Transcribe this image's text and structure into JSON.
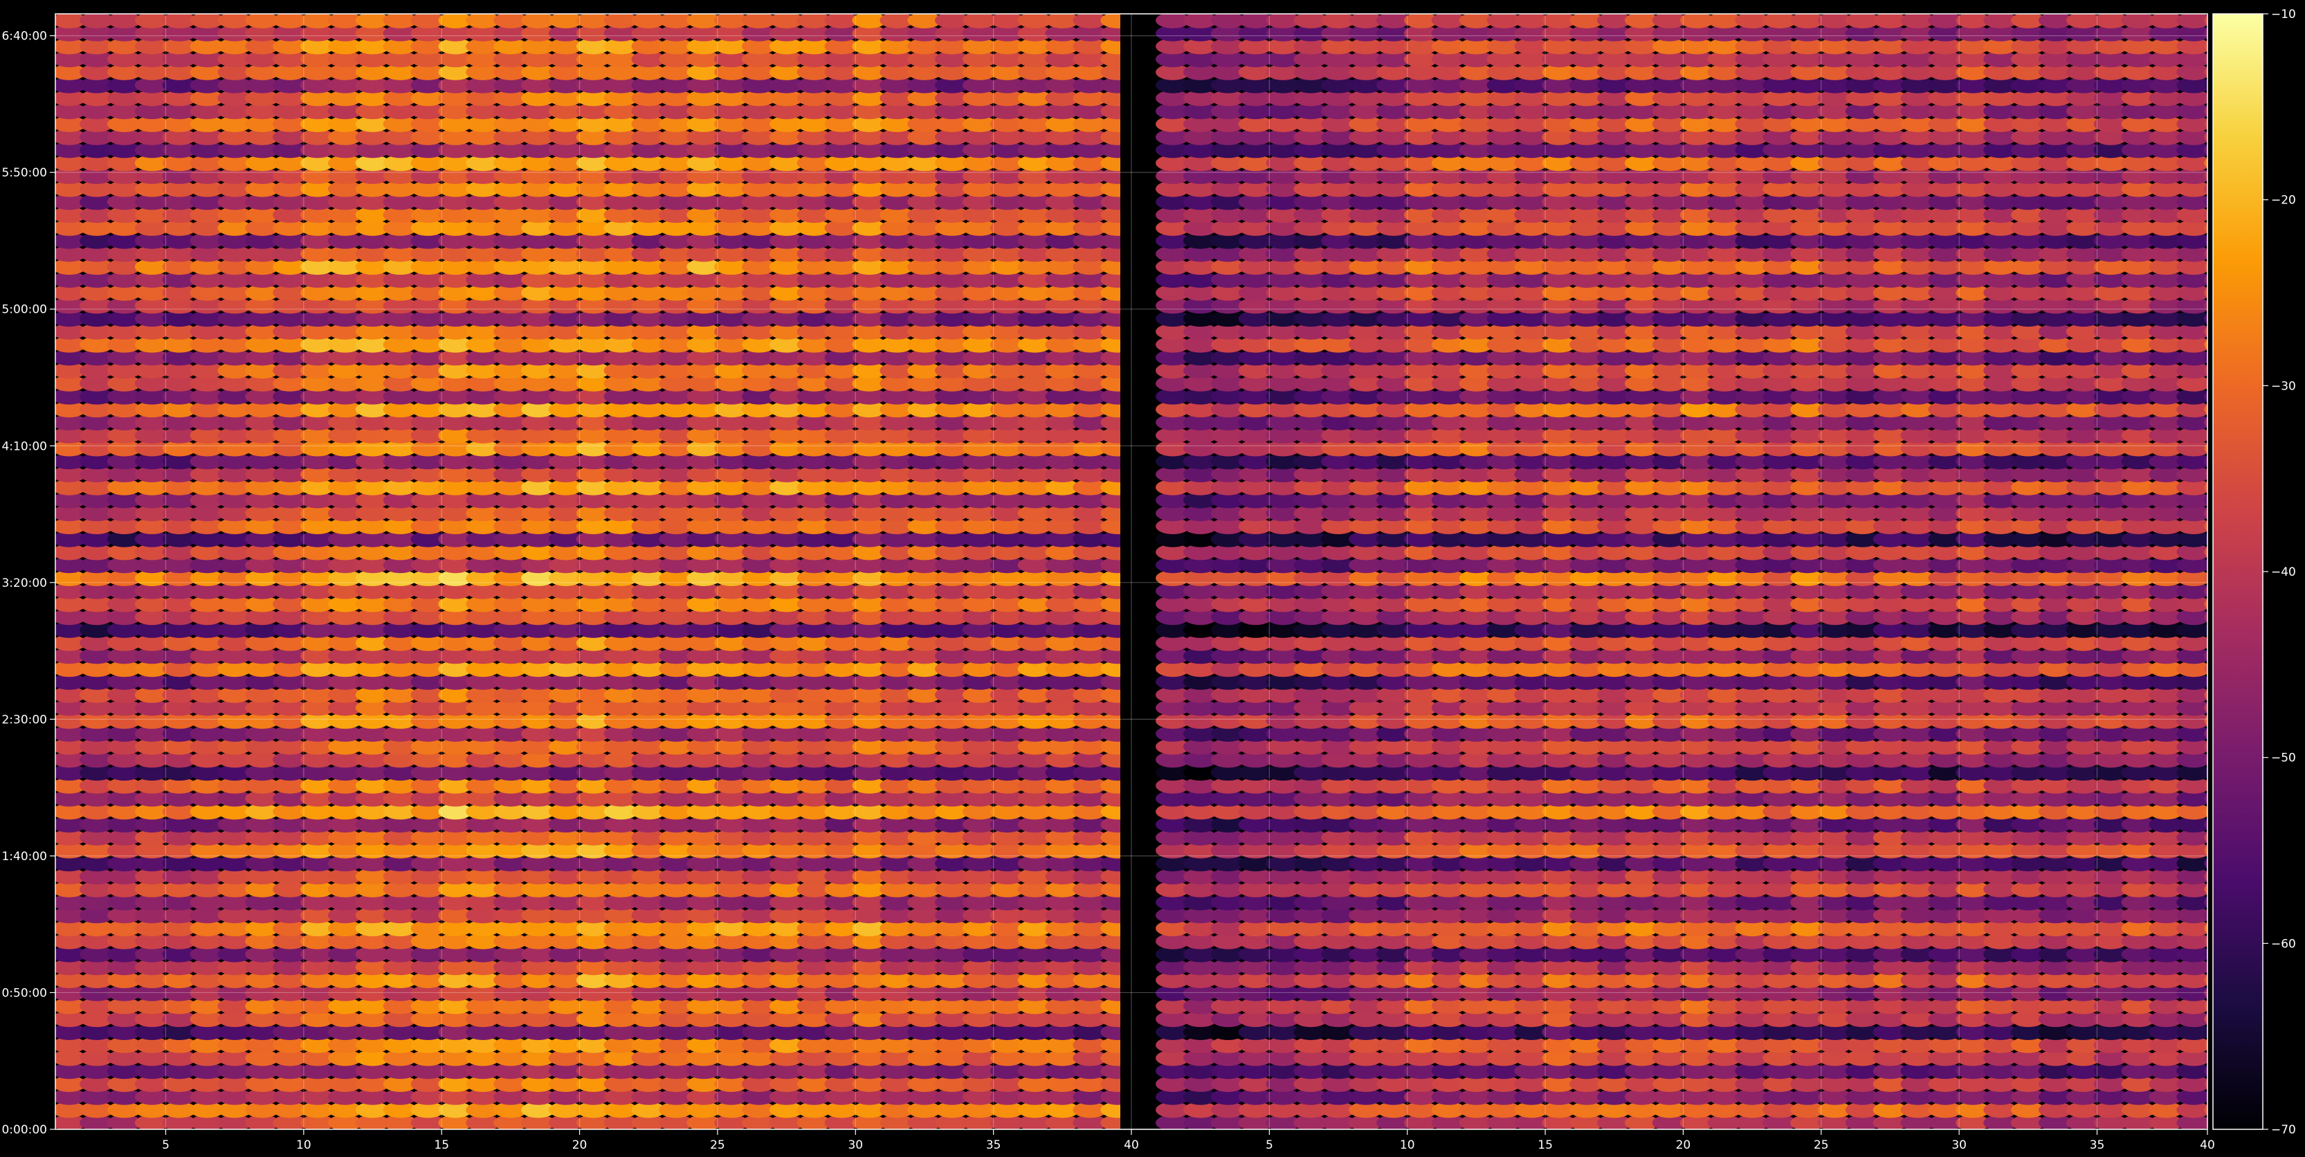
{
  "chart_data": {
    "type": "heatmap",
    "title": "",
    "xlabel": "",
    "ylabel": "",
    "grid": true,
    "background": "#000000",
    "colormap": "inferno",
    "colormap_stops": [
      "#000004",
      "#1b0c41",
      "#4a0c6b",
      "#781c6d",
      "#a52c60",
      "#cf4446",
      "#ed6925",
      "#fb9b06",
      "#f7d13d",
      "#fcffa4"
    ],
    "x_axis": {
      "range": [
        1,
        79
      ],
      "panel_split": 40,
      "ticks": [
        5,
        10,
        15,
        20,
        25,
        30,
        35,
        40,
        45,
        50,
        55,
        60,
        65,
        70,
        75,
        79
      ],
      "tick_labels": [
        "5",
        "10",
        "15",
        "20",
        "25",
        "30",
        "35",
        "40",
        "5",
        "10",
        "15",
        "20",
        "25",
        "30",
        "35",
        "40"
      ]
    },
    "y_axis": {
      "range_seconds": [
        0,
        24480
      ],
      "ticks_seconds": [
        0,
        3000,
        6000,
        9000,
        12000,
        15000,
        18000,
        21000,
        24000
      ],
      "tick_labels": [
        "0:00:00",
        "0:50:00",
        "1:40:00",
        "2:30:00",
        "3:20:00",
        "4:10:00",
        "5:00:00",
        "5:50:00",
        "6:40:00"
      ]
    },
    "colorbar": {
      "range": [
        -70,
        -10
      ],
      "ticks": [
        -70,
        -60,
        -50,
        -40,
        -30,
        -20,
        -10
      ],
      "tick_labels": [
        "−70",
        "−60",
        "−50",
        "−40",
        "−30",
        "−20",
        "−10"
      ]
    },
    "grid_shape": {
      "columns_per_panel": 39,
      "rows": 86
    },
    "panel_bias": [
      0,
      -7
    ],
    "row_levels": [
      -34,
      -24,
      -42,
      -30,
      -46,
      -30,
      -26,
      -52,
      -32,
      -28,
      -40,
      -26,
      -36,
      -48,
      -30,
      -24,
      -38,
      -44,
      -28,
      -34,
      -50,
      -26,
      -32,
      -46,
      -22,
      -40,
      -28,
      -52,
      -36,
      -30,
      -44,
      -26,
      -34,
      -30,
      -48,
      -24,
      -40,
      -28,
      -54,
      -36,
      -28,
      -38,
      -22,
      -44,
      -30,
      -52,
      -28,
      -34,
      -42,
      -24,
      -36,
      -48,
      -26,
      -32,
      -40,
      -24,
      -46,
      -30,
      -28,
      -44,
      -24,
      -30,
      -50,
      -34,
      -28,
      -40,
      -24,
      -34,
      -48,
      -26,
      -30,
      -42,
      -28,
      -36,
      -24,
      -46,
      -34,
      -26,
      -38,
      -30,
      -48,
      -28,
      -34,
      -26,
      -40,
      -30
    ],
    "column_offsets": [
      -6,
      -8,
      -7,
      -5,
      -6,
      -4,
      -4,
      -2,
      -3,
      2,
      1,
      3,
      1,
      0,
      4,
      2,
      0,
      3,
      1,
      4,
      2,
      0,
      -1,
      2,
      0,
      -2,
      1,
      -1,
      -3,
      2,
      -2,
      -1,
      -4,
      -2,
      -3,
      -1,
      -2,
      -4,
      -1
    ]
  }
}
